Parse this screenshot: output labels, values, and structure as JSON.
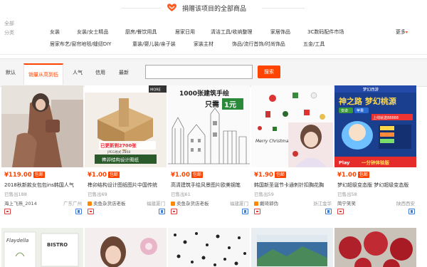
{
  "banner": {
    "title": "捐赠该项目的全部商品"
  },
  "filters": {
    "all_label": "全部",
    "category_label": "分类",
    "row1": [
      "女装",
      "女装/女士精品",
      "厨房/餐饮用具",
      "居家日用",
      "清洁工具/收纳整理",
      "家居饰品",
      "3C数码配件市场"
    ],
    "row2": [
      "居家布艺/窗帘地毯/缝纫DIY",
      "童装/婴儿装/亲子装",
      "家装主材",
      "饰品/流行首饰/时尚饰品",
      "五金/工具"
    ],
    "more_label": "更多"
  },
  "sort": {
    "tabs": [
      "默认",
      "销量从高到低",
      "人气",
      "信用",
      "最新"
    ],
    "active_index": 1,
    "search_value": "",
    "search_button": "搜索"
  },
  "products": [
    {
      "price": "¥119.00",
      "tag": "包邮",
      "title": "2018秋新款女包包ins韩国人气",
      "sold": "已售出188",
      "shop": "海上飞燕_2014",
      "loc": "广东广州"
    },
    {
      "price": "¥1.00",
      "tag": "包邮",
      "title": "榫卯结构设计图纸图片中国传统",
      "sold": "已售出69",
      "shop": "卖鱼杂货店老板",
      "loc": "福建厦门"
    },
    {
      "price": "¥1.00",
      "tag": "包邮",
      "title": "高清建筑手绘风景图片欧美钢笔",
      "sold": "已售出61",
      "shop": "卖鱼杂货店老板",
      "loc": "福建厦门"
    },
    {
      "price": "¥1.90",
      "tag": "包邮",
      "title": "韩国新圣诞节卡通刺针扣胸花胸",
      "sold": "已售出59",
      "shop": "戴琦郭伪",
      "loc": "浙江金华"
    },
    {
      "price": "¥1.00",
      "tag": "包邮",
      "title": "梦幻超级变态版 梦幻超级变态版",
      "sold": "已售出58",
      "shop": "简宁笑笑",
      "loc": "陕西西安"
    }
  ],
  "thumb_text": {
    "p2_top": "MORE",
    "p2_price_line": "已更新到2700张",
    "p2_format": "JPEG格式 2808",
    "p2_caption": "榫卯结构设计图纸",
    "p3_line1": "1000张建筑手绘",
    "p3_line2": "只需",
    "p3_line3": "1元",
    "p4_text": "Merry Christmas",
    "p5_header": "梦幻西游",
    "p5_title": "神之路 梦幻桃源",
    "p5_sub1": "安卓",
    "p5_sub2": "苹果",
    "p5_sub3": "上线就送88888",
    "p5_ribbon": "一分钟体验版",
    "p5_play": "Play",
    "row2_p1": "Flaydella",
    "row2_p2": "BISTRO"
  },
  "colors": {
    "accent": "#ff4400",
    "price": "#ff4400"
  }
}
